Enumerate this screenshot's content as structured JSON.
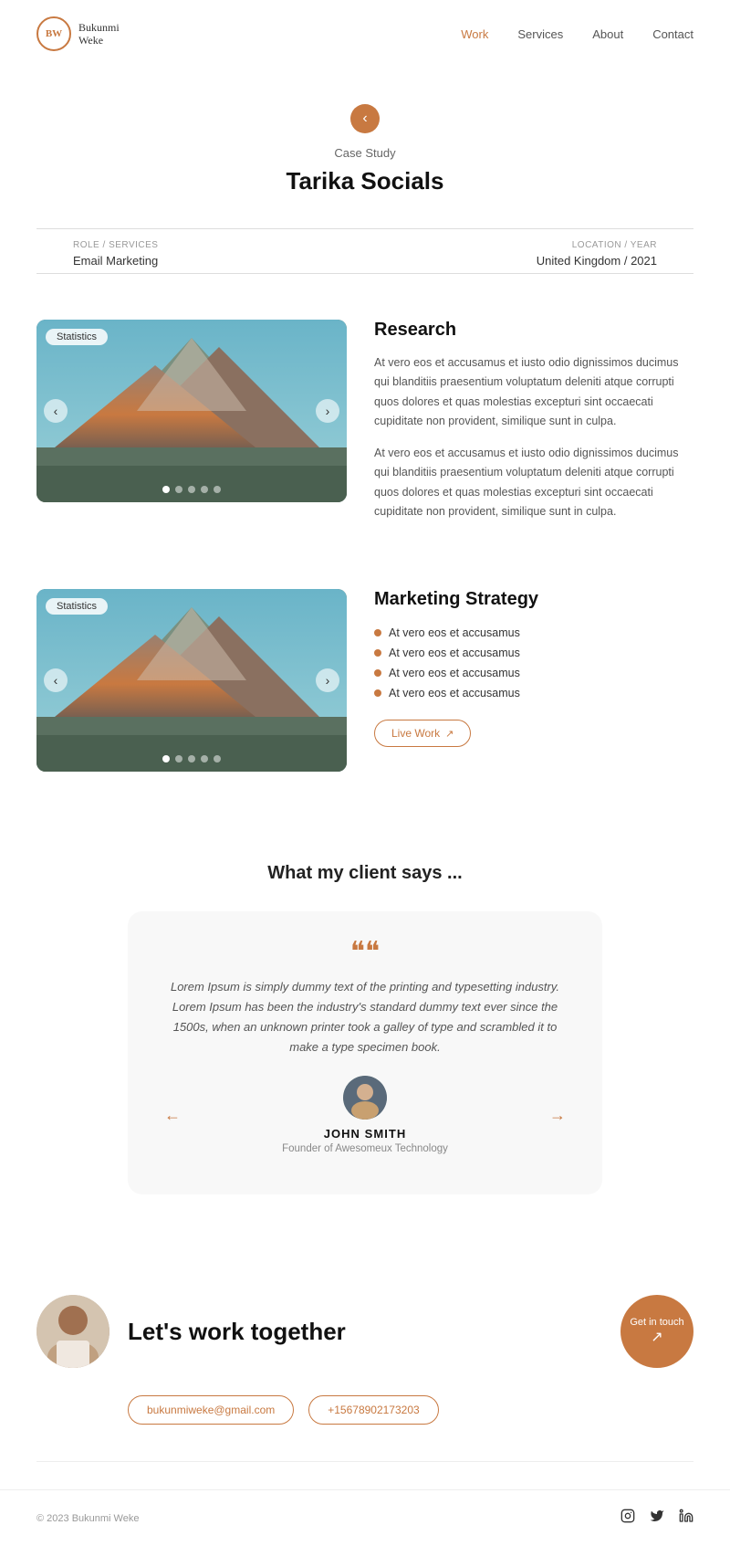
{
  "nav": {
    "logo_initials": "BW",
    "logo_name_line1": "Bukunmi",
    "logo_name_line2": "Weke",
    "links": [
      {
        "label": "Work",
        "active": true
      },
      {
        "label": "Services",
        "active": false
      },
      {
        "label": "About",
        "active": false
      },
      {
        "label": "Contact",
        "active": false
      }
    ]
  },
  "hero": {
    "back_label": "<",
    "case_study_label": "Case Study",
    "project_title": "Tarika Socials"
  },
  "meta": {
    "role_label": "ROLE / SERVICES",
    "role_value": "Email Marketing",
    "location_label": "LOCATION / YEAR",
    "location_value": "United Kingdom / 2021"
  },
  "section1": {
    "img_label": "Statistics",
    "title": "Research",
    "para1": "At vero eos et accusamus et iusto odio dignissimos ducimus qui blanditiis praesentium voluptatum deleniti atque corrupti quos dolores et quas molestias excepturi sint occaecati cupiditate non provident, similique sunt in culpa.",
    "para2": "At vero eos et accusamus et iusto odio dignissimos ducimus qui blanditiis praesentium voluptatum deleniti atque corrupti quos dolores et quas molestias excepturi sint occaecati cupiditate non provident, similique sunt in culpa."
  },
  "section2": {
    "img_label": "Statistics",
    "title": "Marketing Strategy",
    "bullets": [
      "At vero eos et accusamus",
      "At vero eos et accusamus",
      "At vero eos et accusamus",
      "At vero eos et accusamus"
    ],
    "live_work_btn": "Live Work"
  },
  "testimonial": {
    "heading": "What my client says ...",
    "quote": "Lorem Ipsum is simply dummy text of the printing and typesetting industry. Lorem Ipsum has been the industry's standard dummy text ever since the 1500s, when an unknown printer took a galley of type and scrambled it to make a type specimen book.",
    "client_name": "JOHN SMITH",
    "client_title": "Founder of Awesomeux Technology"
  },
  "cta": {
    "heading": "Let's work together",
    "get_in_touch": "Get in touch",
    "email_btn": "bukunmiweke@gmail.com",
    "phone_btn": "+15678902173203"
  },
  "footer": {
    "copy": "© 2023 Bukunmi Weke",
    "social_icons": [
      "instagram",
      "twitter",
      "linkedin"
    ]
  }
}
